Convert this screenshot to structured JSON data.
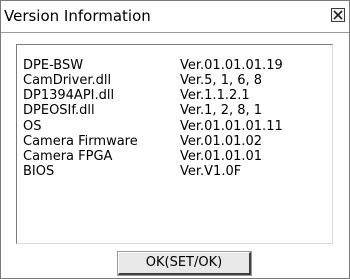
{
  "dialog": {
    "title": "Version Information",
    "close_icon": "close-icon",
    "ok_label": "OK(SET/OK)"
  },
  "versions": [
    {
      "name": "DPE-BSW",
      "version": "Ver.01.01.01.19"
    },
    {
      "name": "CamDriver.dll",
      "version": "Ver.5, 1, 6, 8"
    },
    {
      "name": "DP1394API.dll",
      "version": "Ver.1.1.2.1"
    },
    {
      "name": "DPEOSIf.dll",
      "version": "Ver.1, 2, 8, 1"
    },
    {
      "name": "OS",
      "version": "Ver.01.01.01.11"
    },
    {
      "name": "Camera Firmware",
      "version": "Ver.01.01.02"
    },
    {
      "name": "Camera FPGA",
      "version": "Ver.01.01.01"
    },
    {
      "name": "BIOS",
      "version": "Ver.V1.0F"
    }
  ]
}
